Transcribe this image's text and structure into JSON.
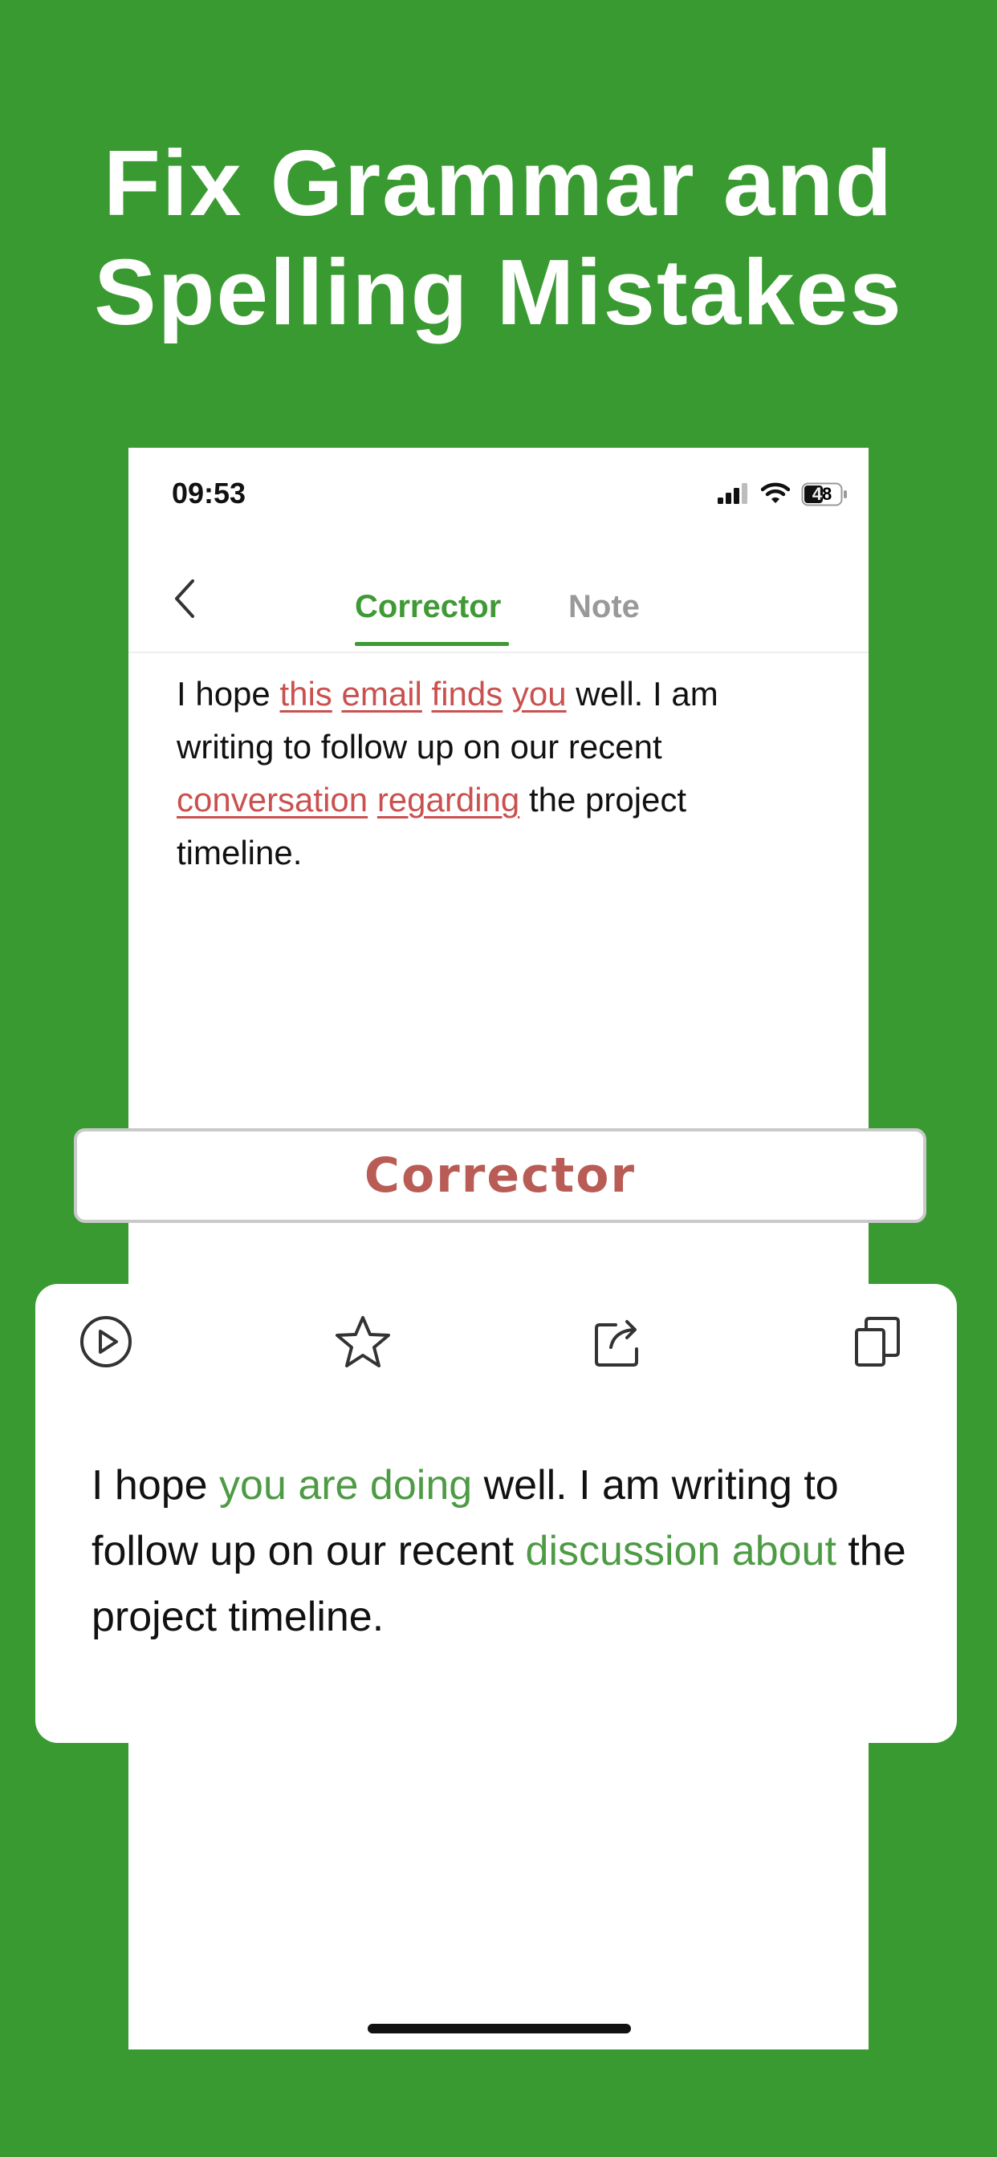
{
  "headline": {
    "line1": "Fix Grammar and",
    "line2": "Spelling Mistakes"
  },
  "status_bar": {
    "time": "09:53",
    "battery": "48"
  },
  "nav": {
    "tabs": [
      {
        "label": "Corrector",
        "active": true
      },
      {
        "label": "Note",
        "active": false
      }
    ]
  },
  "input": {
    "segments": [
      {
        "text": "I hope ",
        "error": false
      },
      {
        "text": "this",
        "error": true
      },
      {
        "text": " ",
        "error": false
      },
      {
        "text": "email",
        "error": true
      },
      {
        "text": " ",
        "error": false
      },
      {
        "text": "finds",
        "error": true
      },
      {
        "text": " ",
        "error": false
      },
      {
        "text": "you",
        "error": true
      },
      {
        "text": " well. I am writing to follow up on our recent ",
        "error": false
      },
      {
        "text": "conversation",
        "error": true
      },
      {
        "text": " ",
        "error": false
      },
      {
        "text": "regarding",
        "error": true
      },
      {
        "text": " the project timeline.",
        "error": false
      }
    ]
  },
  "banner": {
    "label": "Corrector"
  },
  "result": {
    "toolbar": [
      "play-icon",
      "star-icon",
      "share-icon",
      "copy-icon"
    ],
    "segments": [
      {
        "text": "I hope ",
        "fixed": false
      },
      {
        "text": "you are doing",
        "fixed": true
      },
      {
        "text": " well. I am writing to follow up on our recent ",
        "fixed": false
      },
      {
        "text": "discussion about",
        "fixed": true
      },
      {
        "text": " the project timeline.",
        "fixed": false
      }
    ]
  },
  "colors": {
    "background": "#399a31",
    "accent": "#3f9a35",
    "error": "#c9514f",
    "fix": "#4e9b45",
    "banner_text": "#b85c55"
  }
}
